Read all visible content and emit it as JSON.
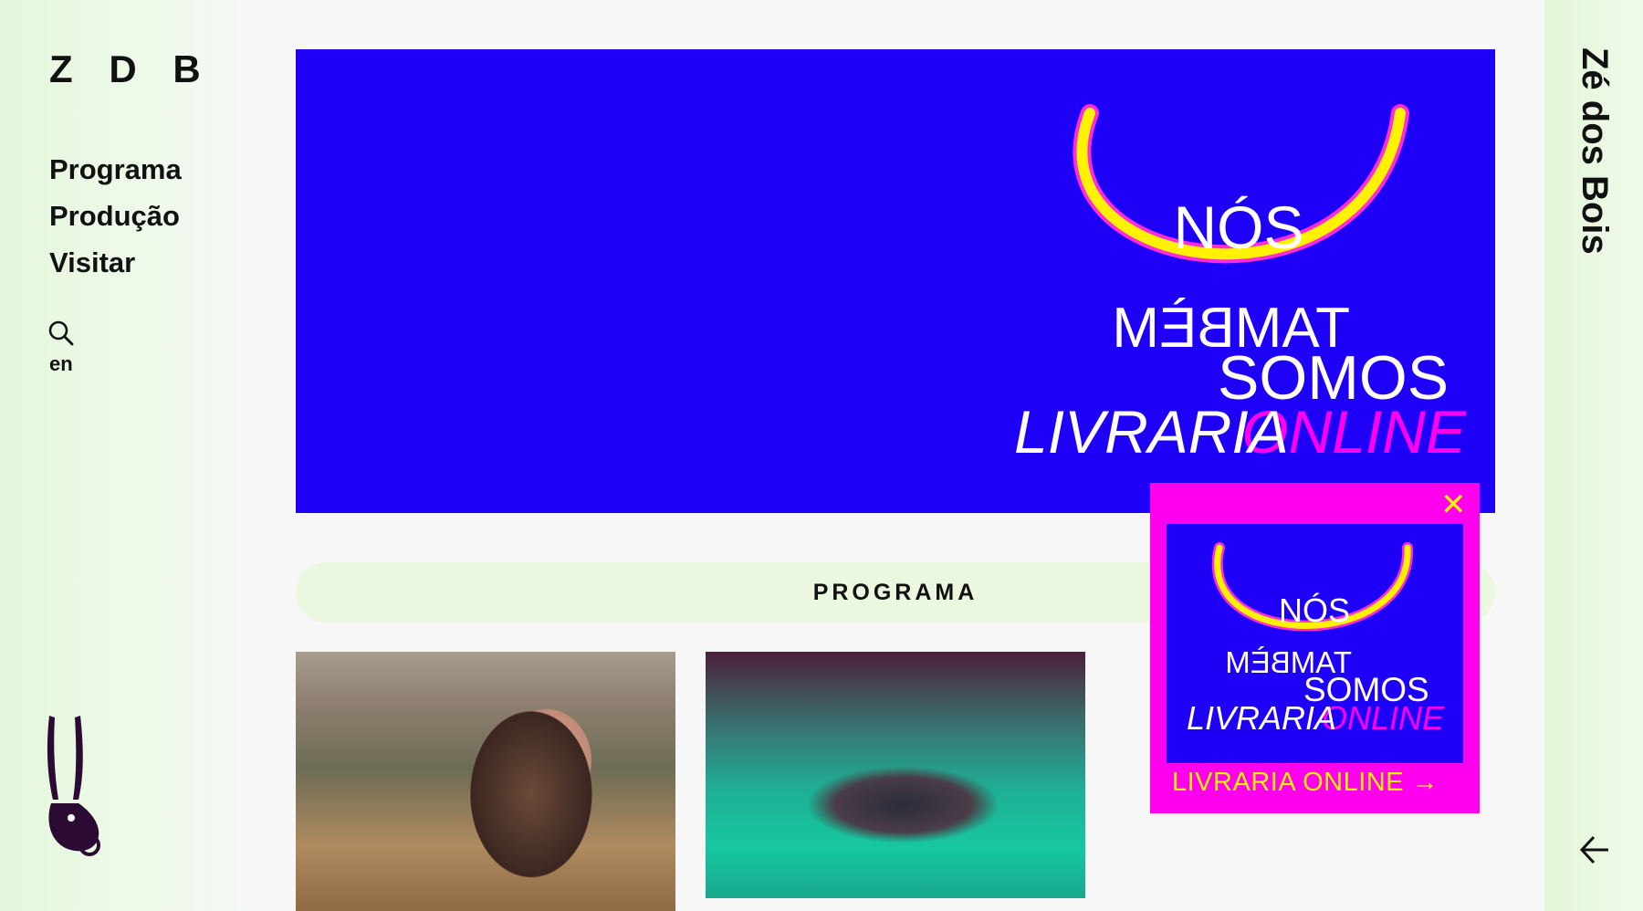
{
  "sidebar": {
    "logo": "Z D B",
    "nav": [
      "Programa",
      "Produção",
      "Visitar"
    ],
    "lang": "en"
  },
  "rightbar": {
    "title": "Zé dos Bois"
  },
  "hero": {
    "word_nos": "NÓS",
    "word_tambem_mirrored": "TAMBÈM",
    "word_somos": "SOMOS",
    "word_livraria": "LIVRARIA",
    "word_online": "ONLINE"
  },
  "section": {
    "programa_label": "PROGRAMA"
  },
  "popup": {
    "close_glyph": "✕",
    "word_nos": "NÓS",
    "word_tambem_mirrored": "TAMBÈM",
    "word_somos": "SOMOS",
    "word_livraria": "LIVRARIA",
    "word_online": "ONLINE",
    "link_label": "LIVRARIA ONLINE →"
  },
  "colors": {
    "brand_blue": "#1f00f7",
    "magenta": "#ff00ee",
    "yellow": "#fff200",
    "mint": "#e9f8de"
  }
}
